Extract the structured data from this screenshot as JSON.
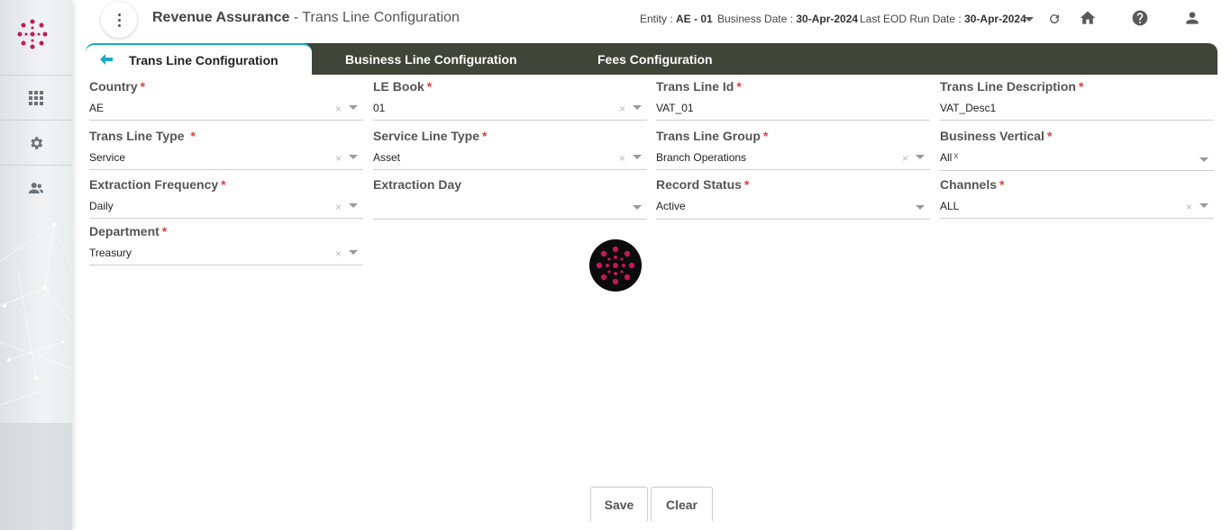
{
  "header": {
    "app_name": "Revenue Assurance",
    "page_name": " - Trans Line Configuration",
    "entity_label": "Entity : ",
    "entity_value": "AE - 01",
    "business_date_label": "Business Date : ",
    "business_date_value": "30-Apr-2024",
    "eod_label": "Last EOD Run Date : ",
    "eod_value": "30-Apr-2024"
  },
  "tabs": [
    {
      "label": "Trans Line Configuration"
    },
    {
      "label": "Business Line Configuration"
    },
    {
      "label": "Fees Configuration"
    }
  ],
  "form": {
    "country": {
      "label": "Country",
      "value": "AE"
    },
    "le_book": {
      "label": "LE Book",
      "value": "01"
    },
    "trans_line_id": {
      "label": "Trans Line Id",
      "value": "VAT_01"
    },
    "trans_line_description": {
      "label": "Trans Line Description",
      "value": "VAT_Desc1"
    },
    "trans_line_type": {
      "label": "Trans Line Type ",
      "value": "Service"
    },
    "service_line_type": {
      "label": "Service Line Type",
      "value": "Asset"
    },
    "trans_line_group": {
      "label": "Trans Line Group",
      "value": "Branch Operations"
    },
    "business_vertical": {
      "label": "Business Vertical",
      "value": "All",
      "chip_remove": "x"
    },
    "extraction_frequency": {
      "label": "Extraction Frequency",
      "value": "Daily"
    },
    "extraction_day": {
      "label": "Extraction Day",
      "value": ""
    },
    "record_status": {
      "label": "Record Status",
      "value": "Active"
    },
    "channels": {
      "label": "Channels",
      "value": "ALL"
    },
    "department": {
      "label": "Department",
      "value": "Treasury"
    }
  },
  "required_marker": "*",
  "clear_glyph": "×",
  "buttons": {
    "save": "Save",
    "clear": "Clear"
  },
  "icons": [
    "menu-kebab-icon",
    "caret-down-icon",
    "refresh-icon",
    "home-icon",
    "help-icon",
    "user-icon",
    "apps-grid-icon",
    "gear-icon",
    "users-icon",
    "back-arrow-icon"
  ],
  "colors": {
    "tabbar": "#3f4538",
    "accent": "#19a9c5",
    "required": "#e0413a",
    "brand": "#c2185b"
  }
}
